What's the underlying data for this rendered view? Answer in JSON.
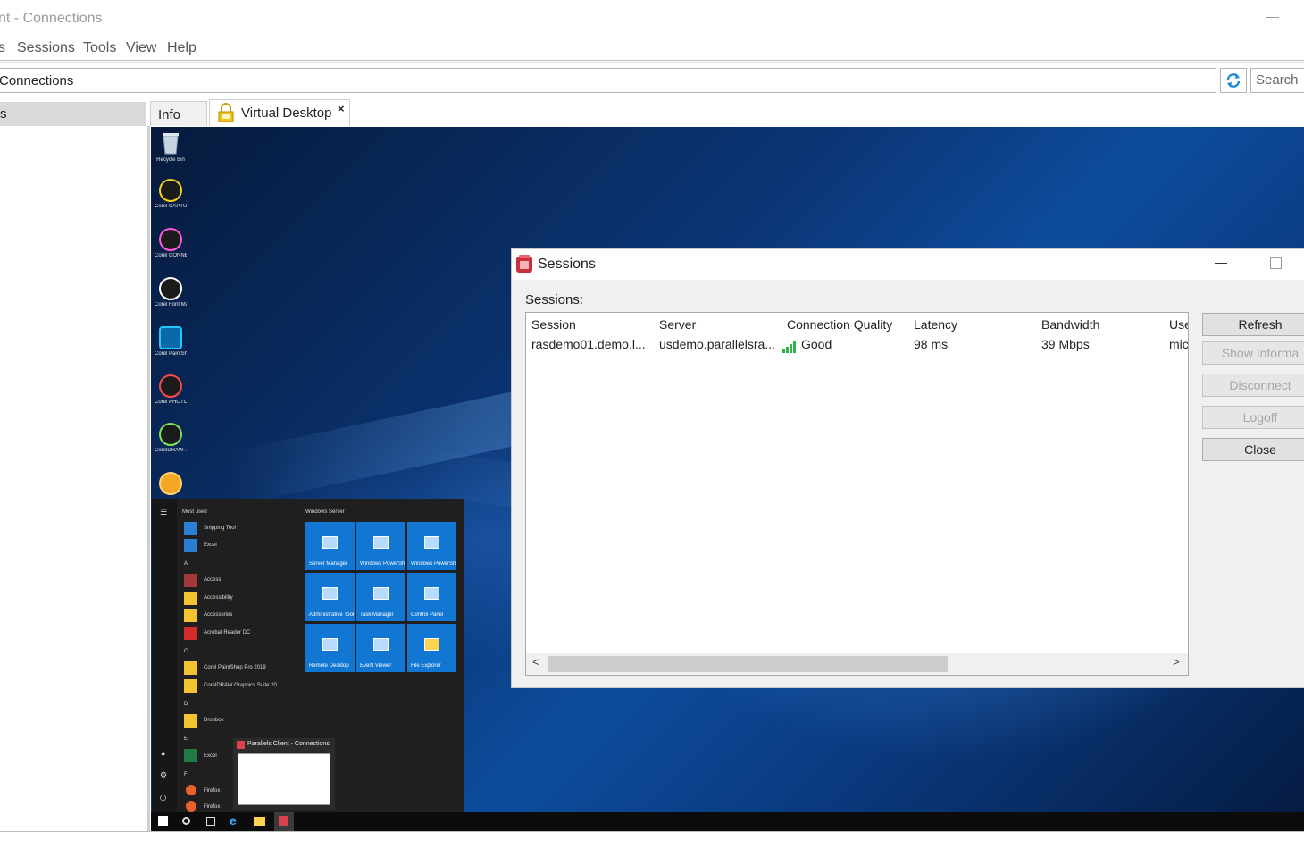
{
  "window": {
    "title": "nt - Connections"
  },
  "menu": {
    "items": [
      "s",
      "Sessions",
      "Tools",
      "View",
      "Help"
    ]
  },
  "address": {
    "value": "Connections",
    "search_placeholder": "Search"
  },
  "sidebar": {
    "items": [
      {
        "label": "s"
      }
    ]
  },
  "tabs": [
    {
      "label": "Info"
    },
    {
      "label": "Virtual Desktop",
      "close": "×"
    }
  ],
  "desktop": {
    "icons": [
      {
        "label": "Recycle Bin",
        "icon": "recycle-bin-icon"
      },
      {
        "label": "Corel CAPTURE...",
        "icon": "corel-capture-icon"
      },
      {
        "label": "Corel CONNECT...",
        "icon": "corel-connect-icon"
      },
      {
        "label": "Corel Font Manager 2...",
        "icon": "corel-font-manager-icon"
      },
      {
        "label": "Corel PaintSh...",
        "icon": "corel-paintshop-icon"
      },
      {
        "label": "Corel PHOTO-PA...",
        "icon": "corel-photo-paint-icon"
      },
      {
        "label": "CorelDRAW ...",
        "icon": "coreldraw-icon"
      },
      {
        "label": "",
        "icon": "corel-app-icon"
      }
    ],
    "start_menu": {
      "most_used_header": "Most used",
      "most_used": [
        "Snipping Tool",
        "Excel"
      ],
      "groups": [
        {
          "letter": "A",
          "items": [
            "Access",
            "Accessibility",
            "Accessories",
            "Acrobat Reader DC"
          ]
        },
        {
          "letter": "C",
          "items": [
            "Corel PaintShop Pro 2019",
            "CorelDRAW Graphics Suite 20..."
          ]
        },
        {
          "letter": "D",
          "items": [
            "Dropbox"
          ]
        },
        {
          "letter": "E",
          "items": [
            "Excel"
          ]
        },
        {
          "letter": "F",
          "items": [
            "Firefox",
            "Firefox"
          ]
        }
      ],
      "tiles_header": "Windows Server",
      "tiles": [
        "Server Manager",
        "Windows PowerShell",
        "Windows PowerShell ISE",
        "Administrative Tools",
        "Task Manager",
        "Control Panel",
        "Remote Desktop",
        "Event Viewer",
        "File Explorer"
      ],
      "thumbnail_caption": "Parallels Client - Connections"
    }
  },
  "dialog": {
    "title": "Sessions",
    "sessions_label": "Sessions:",
    "columns": [
      "Session",
      "Server",
      "Connection Quality",
      "Latency",
      "Bandwidth",
      "Use"
    ],
    "rows": [
      {
        "session": "rasdemo01.demo.l...",
        "server": "usdemo.parallelsra...",
        "quality": "Good",
        "latency": "98 ms",
        "bandwidth": "39 Mbps",
        "user": "mic"
      }
    ],
    "buttons": {
      "refresh": "Refresh",
      "show_info": "Show Informa",
      "disconnect": "Disconnect",
      "logoff": "Logoff",
      "close": "Close"
    },
    "scroll_left": "<",
    "scroll_right": ">"
  }
}
